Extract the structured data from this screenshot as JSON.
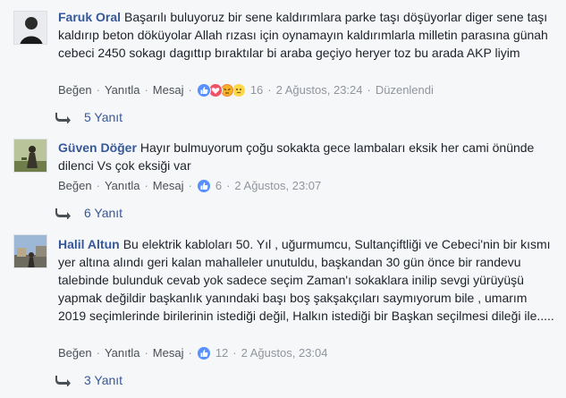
{
  "comments": [
    {
      "author": "Faruk Oral",
      "text": "Başarılı buluyoruz bir sene kaldırımlara parke taşı döşüyorlar diger sene taşı kaldırıp beton döküyolar Allah rızası için oynamayın kaldırımlarla milletin parasına günah cebeci 2450 sokagı dagıttıp bıraktılar bi araba geçiyo heryer toz bu arada AKP liyim",
      "like": "Beğen",
      "reply": "Yanıtla",
      "message": "Mesaj",
      "reactions": [
        "like-icon",
        "love-icon",
        "angry-icon",
        "sad-icon"
      ],
      "reaction_count": "16",
      "time": "2 Ağustos, 23:24",
      "edited": "Düzenlendi",
      "replies_label": "5 Yanıt"
    },
    {
      "author": "Güven Döğer",
      "text": "Hayır bulmuyorum çoğu sokakta gece lambaları eksik her cami önünde dilenci Vs çok eksiği var",
      "like": "Beğen",
      "reply": "Yanıtla",
      "message": "Mesaj",
      "reactions": [
        "like-icon"
      ],
      "reaction_count": "6",
      "time": "2 Ağustos, 23:07",
      "replies_label": "6 Yanıt"
    },
    {
      "author": "Halil Altun",
      "text": "Bu elektrik kabloları 50. Yıl , uğurmumcu, Sultançiftliği ve Cebeci'nin bir kısmı yer altına alındı geri kalan mahalleler unutuldu, başkandan 30 gün önce bir randevu talebinde bulunduk cevab yok sadece seçim Zaman'ı sokaklara inilip sevgi yürüyüşü yapmak değildir başkanlık yanındaki başı boş şakşakçıları saymıyorum bile , umarım 2019 seçimlerinde birilerinin istediği değil, Halkın istediği bir Başkan seçilmesi dileği ile.....",
      "like": "Beğen",
      "reply": "Yanıtla",
      "message": "Mesaj",
      "reactions": [
        "like-icon"
      ],
      "reaction_count": "12",
      "time": "2 Ağustos, 23:04",
      "replies_label": "3 Yanıt"
    }
  ],
  "colors": {
    "background": "#f6f7f9",
    "author": "#365899",
    "meta": "#90949c",
    "like_blue": "#5890ff",
    "love_red": "#f25268",
    "reaction_yellow": "#fcd84a"
  }
}
